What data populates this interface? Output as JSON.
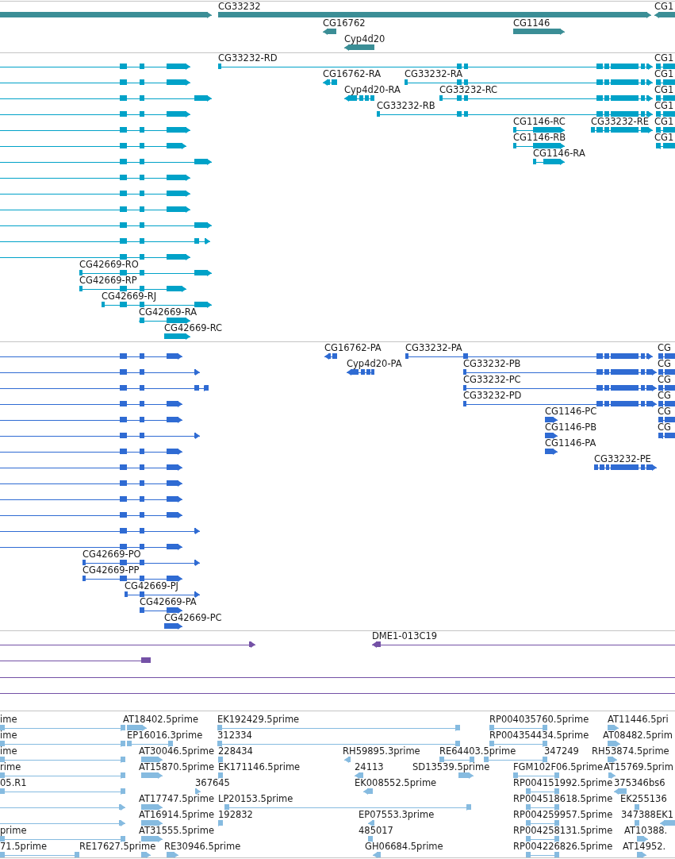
{
  "tracks": [
    {
      "kind": "gene",
      "color": "#3b8e96",
      "features": [
        {
          "label": "CG33232"
        },
        {
          "label": "CG1"
        },
        {
          "label": "CG16762"
        },
        {
          "label": "CG1146"
        },
        {
          "label": "Cyp4d20"
        }
      ]
    },
    {
      "kind": "mrna",
      "color": "#00a2c8",
      "features": [
        {
          "label": "CG33232-RD"
        },
        {
          "label": "CG1"
        },
        {
          "label": "CG16762-RA"
        },
        {
          "label": "CG33232-RA"
        },
        {
          "label": "CG1"
        },
        {
          "label": "Cyp4d20-RA"
        },
        {
          "label": "CG33232-RC"
        },
        {
          "label": "CG1"
        },
        {
          "label": "CG33232-RB"
        },
        {
          "label": "CG1"
        },
        {
          "label": "CG1146-RC"
        },
        {
          "label": "CG33232-RE"
        },
        {
          "label": "CG1"
        },
        {
          "label": "CG1146-RB"
        },
        {
          "label": "CG1"
        },
        {
          "label": "CG1146-RA"
        },
        {
          "label": "CG42669-RO"
        },
        {
          "label": "CG42669-RP"
        },
        {
          "label": "CG42669-RJ"
        },
        {
          "label": "CG42669-RA"
        },
        {
          "label": "CG42669-RC"
        }
      ]
    },
    {
      "kind": "protein",
      "color": "#2f6bd3",
      "features": [
        {
          "label": "CG16762-PA"
        },
        {
          "label": "CG33232-PA"
        },
        {
          "label": "CG"
        },
        {
          "label": "Cyp4d20-PA"
        },
        {
          "label": "CG33232-PB"
        },
        {
          "label": "CG"
        },
        {
          "label": "CG33232-PC"
        },
        {
          "label": "CG"
        },
        {
          "label": "CG33232-PD"
        },
        {
          "label": "CG"
        },
        {
          "label": "CG1146-PC"
        },
        {
          "label": "CG"
        },
        {
          "label": "CG1146-PB"
        },
        {
          "label": "CG"
        },
        {
          "label": "CG1146-PA"
        },
        {
          "label": "CG33232-PE"
        },
        {
          "label": "CG42669-PO"
        },
        {
          "label": "CG42669-PP"
        },
        {
          "label": "CG42669-PJ"
        },
        {
          "label": "CG42669-PA"
        },
        {
          "label": "CG42669-PC"
        }
      ]
    },
    {
      "kind": "clone",
      "color": "#7451a6",
      "features": [
        {
          "label": "DME1-013C19"
        }
      ]
    },
    {
      "kind": "est",
      "color": "#86bbe0",
      "features": [
        {
          "label": "ime"
        },
        {
          "label": "AT18402.5prime"
        },
        {
          "label": "EK192429.5prime"
        },
        {
          "label": "RP004035760.5prime"
        },
        {
          "label": "AT11446.5pri"
        },
        {
          "label": "ime"
        },
        {
          "label": "EP16016.3prime"
        },
        {
          "label": "312334"
        },
        {
          "label": "RP004354434.5prime"
        },
        {
          "label": "AT08482.5prim"
        },
        {
          "label": "ime"
        },
        {
          "label": "AT30046.5prime"
        },
        {
          "label": "228434"
        },
        {
          "label": "RH59895.3prime"
        },
        {
          "label": "RE64403.5prime"
        },
        {
          "label": "347249"
        },
        {
          "label": "RH53874.5prime"
        },
        {
          "label": "rime"
        },
        {
          "label": "AT15870.5prime"
        },
        {
          "label": "EK171146.5prime"
        },
        {
          "label": "24113"
        },
        {
          "label": "SD13539.5prime"
        },
        {
          "label": "FGM102F06.5prime"
        },
        {
          "label": "AT15769.5prim"
        },
        {
          "label": "05.R1"
        },
        {
          "label": "367645"
        },
        {
          "label": "EK008552.5prime"
        },
        {
          "label": "RP004151992.5prime"
        },
        {
          "label": "375346bs6"
        },
        {
          "label": "AT17747.5prime"
        },
        {
          "label": "LP20153.5prime"
        },
        {
          "label": "RP004518618.5prime"
        },
        {
          "label": "EK255136"
        },
        {
          "label": "AT16914.5prime"
        },
        {
          "label": "192832"
        },
        {
          "label": "EP07553.3prime"
        },
        {
          "label": "RP004259957.5prime"
        },
        {
          "label": "347388"
        },
        {
          "label": "EK1"
        },
        {
          "label": "prime"
        },
        {
          "label": "AT31555.5prime"
        },
        {
          "label": "485017"
        },
        {
          "label": "RP004258131.5prime"
        },
        {
          "label": "AT10388."
        },
        {
          "label": "71.5prime"
        },
        {
          "label": "RE17627.5prime"
        },
        {
          "label": "RE30946.5prime"
        },
        {
          "label": "GH06684.5prime"
        },
        {
          "label": "RP004226826.5prime"
        },
        {
          "label": "AT14952."
        }
      ]
    }
  ]
}
